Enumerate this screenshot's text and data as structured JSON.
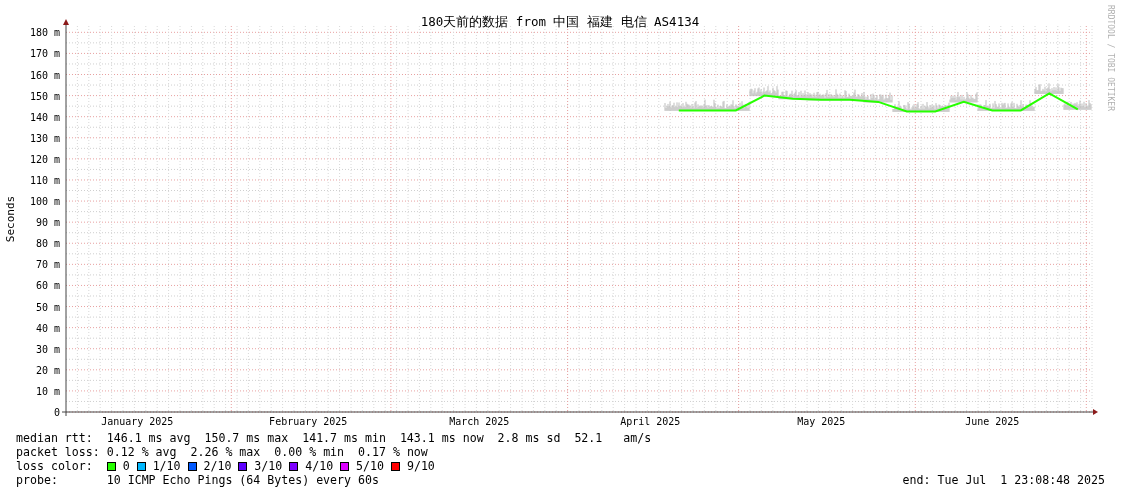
{
  "chart": {
    "title": "180天前的数据 from 中国 福建 电信 AS4134",
    "credit": "RRDTOOL / TOBI OETIKER",
    "chart_data": {
      "type": "line",
      "ylabel": "Seconds",
      "categories": [
        null,
        null,
        "January 2025",
        null,
        null,
        null,
        null,
        null,
        "February 2025",
        null,
        null,
        null,
        null,
        null,
        "March 2025",
        null,
        null,
        null,
        null,
        null,
        "April 2025",
        null,
        null,
        null,
        null,
        null,
        "May 2025",
        null,
        null,
        null,
        null,
        null,
        "June 2025",
        null,
        null,
        null
      ],
      "series": [
        {
          "color": "#26ff00",
          "values": [
            null,
            null,
            null,
            null,
            null,
            null,
            null,
            null,
            null,
            null,
            null,
            null,
            null,
            null,
            null,
            null,
            null,
            null,
            null,
            null,
            null,
            143,
            143,
            143,
            150,
            148.5,
            148,
            148,
            147,
            142.5,
            142.5,
            147,
            143,
            143,
            151,
            143.5
          ]
        }
      ],
      "ylim": [
        0,
        183
      ],
      "grid": true,
      "yticks": [
        {
          "value": 0,
          "label": "0"
        },
        {
          "value": 10,
          "label": "10 m"
        },
        {
          "value": 20,
          "label": "20 m"
        },
        {
          "value": 30,
          "label": "30 m"
        },
        {
          "value": 40,
          "label": "40 m"
        },
        {
          "value": 50,
          "label": "50 m"
        },
        {
          "value": 60,
          "label": "60 m"
        },
        {
          "value": 70,
          "label": "70 m"
        },
        {
          "value": 80,
          "label": "80 m"
        },
        {
          "value": 90,
          "label": "90 m"
        },
        {
          "value": 100,
          "label": "100 m"
        },
        {
          "value": 110,
          "label": "110 m"
        },
        {
          "value": 120,
          "label": "120 m"
        },
        {
          "value": 130,
          "label": "130 m"
        },
        {
          "value": 140,
          "label": "140 m"
        },
        {
          "value": 150,
          "label": "150 m"
        },
        {
          "value": 160,
          "label": "160 m"
        },
        {
          "value": 170,
          "label": "170 m"
        },
        {
          "value": 180,
          "label": "180 m"
        }
      ]
    }
  },
  "legend": {
    "median_rtt": {
      "label": "median rtt:",
      "values": [
        "146.1 ms avg",
        "150.7 ms max",
        "141.7 ms min",
        "143.1 ms now",
        "2.8 ms sd",
        "52.1   am/s"
      ]
    },
    "packet_loss": {
      "label": "packet loss:",
      "values": [
        "0.12 % avg",
        "2.26 % max",
        "0.00 % min",
        "0.17 % now"
      ]
    },
    "loss_colors": {
      "label": "loss color:",
      "items": [
        {
          "label": "0",
          "color": "#26ff00"
        },
        {
          "label": "1/10",
          "color": "#00b8ff"
        },
        {
          "label": "2/10",
          "color": "#0059ff"
        },
        {
          "label": "3/10",
          "color": "#5e00ff"
        },
        {
          "label": "4/10",
          "color": "#7e00ff"
        },
        {
          "label": "5/10",
          "color": "#dd00ff"
        },
        {
          "label": "9/10",
          "color": "#ff0000"
        }
      ]
    },
    "probe": {
      "label": "probe:",
      "value": "10 ICMP Echo Pings (64 Bytes) every 60s"
    },
    "end": "end: Tue Jul  1 23:08:48 2025"
  }
}
